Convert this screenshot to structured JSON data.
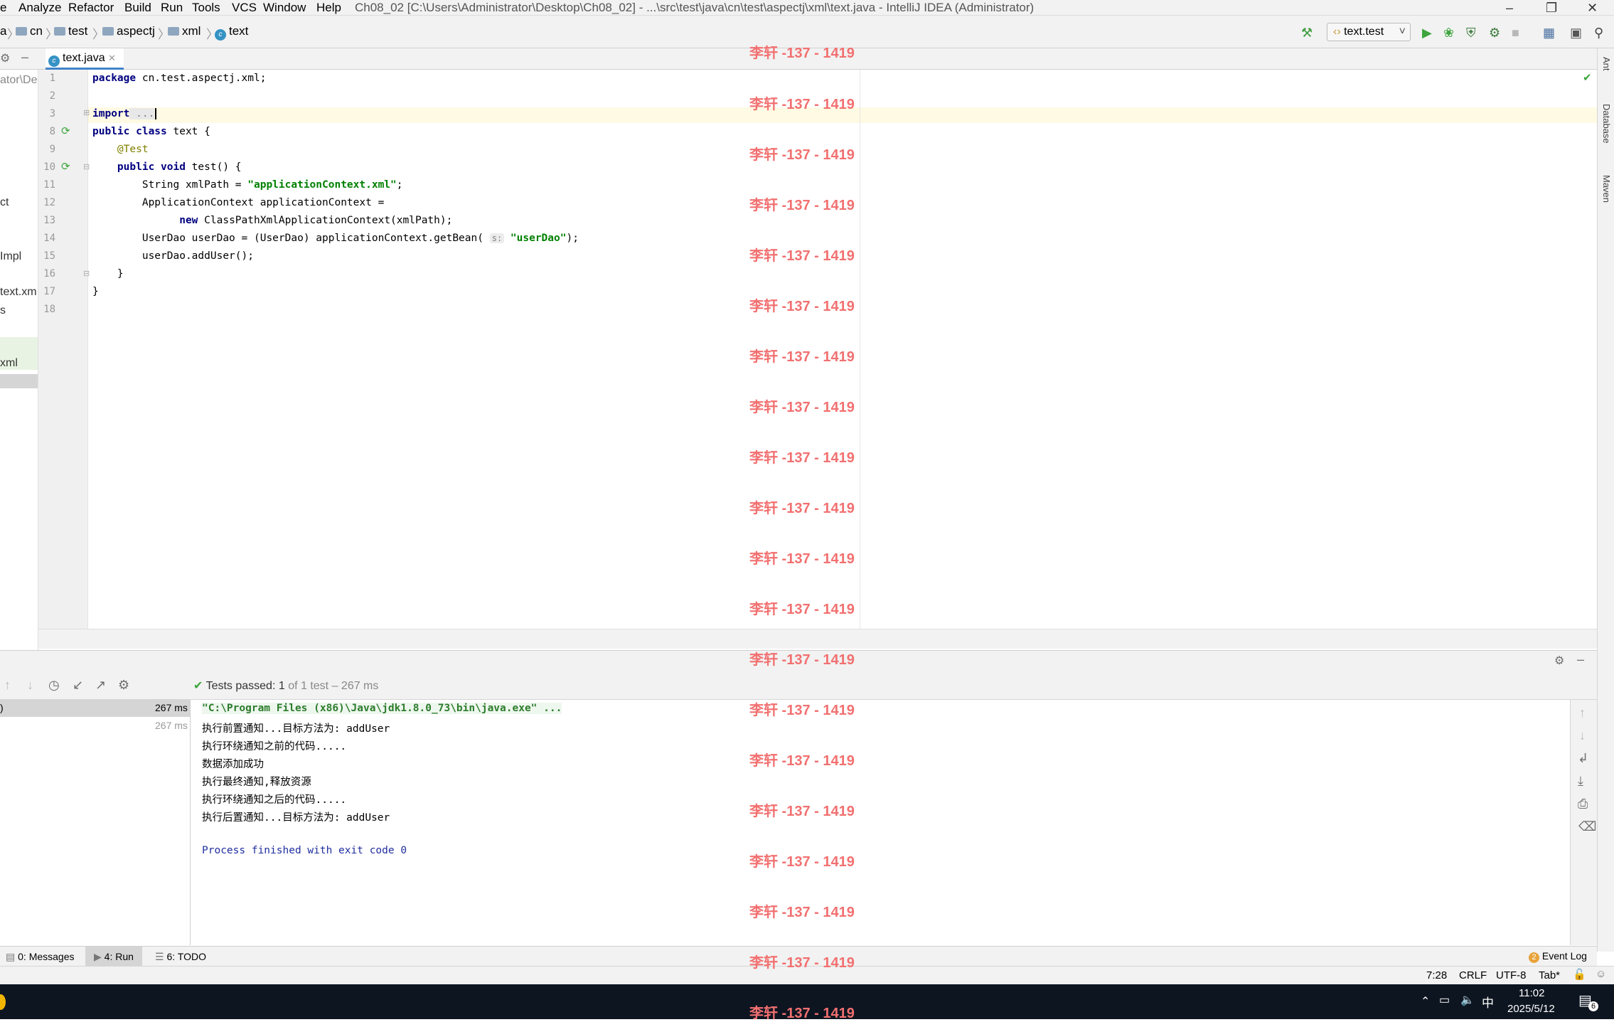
{
  "menu": [
    "Analyze",
    "Refactor",
    "Build",
    "Run",
    "Tools",
    "VCS",
    "Window",
    "Help"
  ],
  "window_title": "Ch08_02 [C:\\Users\\Administrator\\Desktop\\Ch08_02] - ...\\src\\test\\java\\cn\\test\\aspectj\\xml\\text.java - IntelliJ IDEA (Administrator)",
  "breadcrumbs": [
    "cn",
    "test",
    "aspectj",
    "xml",
    "text"
  ],
  "run_config": "text.test",
  "file_tab": "text.java",
  "project_fragments": [
    "ator\\Des",
    "ct",
    "Impl",
    "text.xm",
    "s",
    "xml"
  ],
  "line_numbers": [
    "1",
    "2",
    "3",
    "8",
    "9",
    "10",
    "11",
    "12",
    "13",
    "14",
    "15",
    "16",
    "17",
    "18"
  ],
  "code": {
    "l1_kw": "package",
    "l1_rest": " cn.test.aspectj.xml;",
    "l3_kw": "import",
    "l3_rest": " ...",
    "l8_kw": "public class",
    "l8_rest": " text {",
    "l9_ann": "@Test",
    "l10_kw": "public void",
    "l10_rest": " test() {",
    "l11_a": "String xmlPath = ",
    "l11_str": "\"applicationContext.xml\"",
    "l11_b": ";",
    "l12": "ApplicationContext applicationContext =",
    "l13_kw": "new",
    "l13_rest": " ClassPathXmlApplicationContext(xmlPath);",
    "l14_a": "UserDao userDao = (UserDao) applicationContext.getBean(",
    "l14_hint": "s:",
    "l14_str": "\"userDao\"",
    "l14_b": ");",
    "l15": "userDao.addUser();",
    "l16": "}",
    "l17": "}"
  },
  "right_tools": [
    "Ant",
    "Database",
    "Maven"
  ],
  "run": {
    "status_prefix": "Tests passed:",
    "status_count": "1",
    "status_suffix": "of 1 test – 267 ms",
    "tree_time_1": "267 ms",
    "tree_time_2": "267 ms",
    "tree_paren": ")"
  },
  "console": [
    "\"C:\\Program Files (x86)\\Java\\jdk1.8.0_73\\bin\\java.exe\" ...",
    "执行前置通知...目标方法为: addUser",
    "执行环绕通知之前的代码.....",
    "数据添加成功",
    "执行最终通知,释放资源",
    "执行环绕通知之后的代码.....",
    "执行后置通知...目标方法为: addUser",
    "Process finished with exit code 0"
  ],
  "bottom_tabs": [
    "0: Messages",
    "4: Run",
    "6: TODO"
  ],
  "event_log": "Event Log",
  "event_count": "2",
  "status": {
    "position": "7:28",
    "line_sep": "CRLF",
    "encoding": "UTF-8",
    "indent": "Tab*"
  },
  "taskbar": {
    "time": "11:02",
    "date": "2025/5/12",
    "ime": "中",
    "notif": "6"
  },
  "watermark": "李轩 -137 - 1419"
}
